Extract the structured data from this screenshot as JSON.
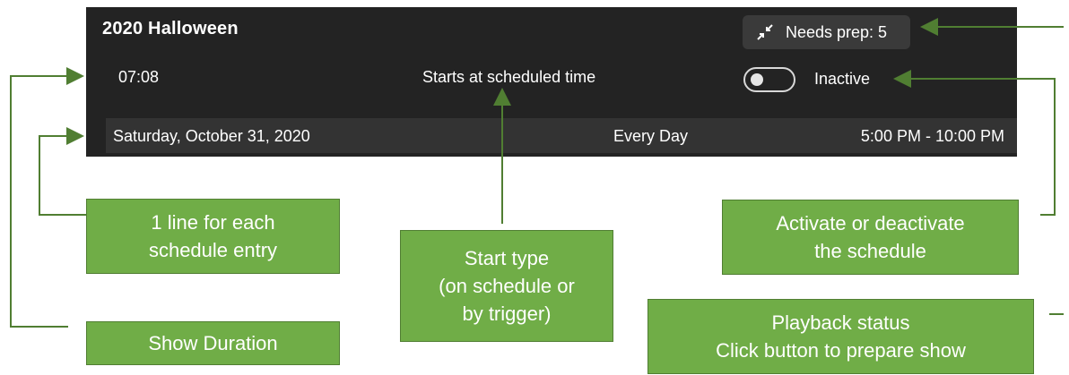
{
  "schedule": {
    "title": "2020 Halloween",
    "prep_button_label": "Needs prep: 5",
    "time": "07:08",
    "start_type": "Starts at scheduled time",
    "toggle_state_label": "Inactive",
    "toggle_on": false,
    "entries": [
      {
        "date": "Saturday, October 31, 2020",
        "recurrence": "Every Day",
        "hours": "5:00 PM - 10:00 PM"
      }
    ]
  },
  "callouts": {
    "entry_line": "1 line for each\nschedule entry",
    "show_duration": "Show Duration",
    "start_type": "Start type\n(on schedule or\nby trigger)",
    "activate": "Activate or deactivate\nthe schedule",
    "playback": "Playback status\nClick button to prepare show"
  },
  "colors": {
    "panel_bg": "#232323",
    "entry_bg": "#333333",
    "callout_bg": "#70ad47",
    "connector": "#507e32"
  },
  "icons": {
    "prep": "collapse-arrows-icon"
  }
}
